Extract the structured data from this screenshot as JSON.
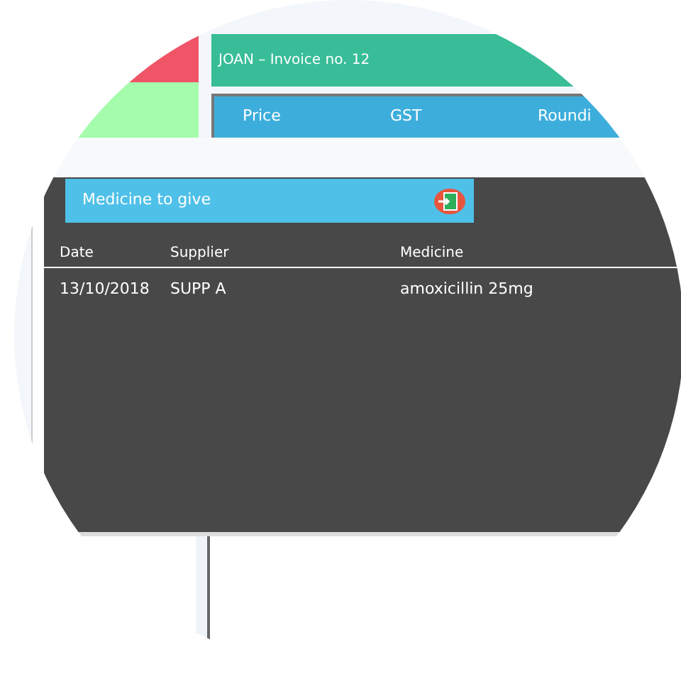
{
  "invoice_header": {
    "title": "JOAN – Invoice no. 12"
  },
  "invoice_columns": [
    "Price",
    "GST",
    "Roundi"
  ],
  "panel": {
    "title": "Medicine to give",
    "table": {
      "columns": [
        "Date",
        "Supplier",
        "Medicine"
      ],
      "rows": [
        [
          "13/10/2018",
          "SUPP A",
          "amoxicillin 25mg"
        ]
      ]
    }
  }
}
